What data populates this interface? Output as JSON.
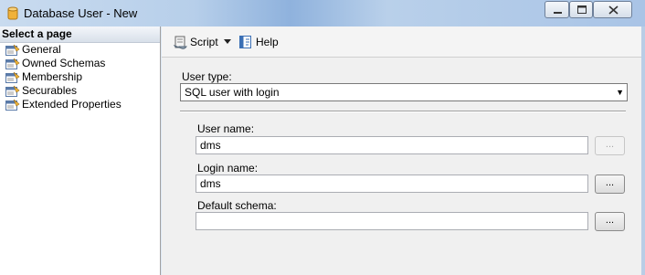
{
  "window": {
    "title": "Database User - New"
  },
  "left_panel": {
    "header": "Select a page",
    "pages": [
      "General",
      "Owned Schemas",
      "Membership",
      "Securables",
      "Extended Properties"
    ]
  },
  "toolbar": {
    "script_label": "Script",
    "help_label": "Help"
  },
  "form": {
    "user_type_label": "User type:",
    "user_type_value": "SQL user with login",
    "user_name_label": "User name:",
    "user_name_value": "dms",
    "login_name_label": "Login name:",
    "login_name_value": "dms",
    "default_schema_label": "Default schema:",
    "default_schema_value": "",
    "browse_label": "..."
  }
}
